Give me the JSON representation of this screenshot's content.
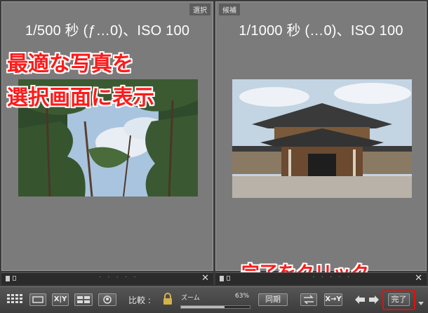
{
  "left_pane": {
    "tag": "選択",
    "meta": "1/500 秒 (ƒ…0)、ISO 100"
  },
  "right_pane": {
    "tag": "候補",
    "meta": "1/1000 秒 (…0)、ISO 100"
  },
  "callouts": {
    "line1": "最適な写真を",
    "line2": "選択画面に表示",
    "done": "完了をクリック"
  },
  "strip": {
    "dots": "· · · · ·",
    "close": "✕"
  },
  "toolbar": {
    "compare_label": "比較 :",
    "zoom_label": "ズーム",
    "zoom_value": "63%",
    "zoom_fraction": 0.63,
    "sync_label": "同期",
    "done_label": "完了"
  },
  "colors": {
    "callout": "#ff1a1a",
    "highlight": "#e01010"
  }
}
